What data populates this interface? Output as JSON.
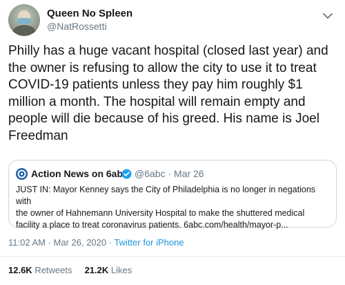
{
  "author": {
    "display_name": "Queen No Spleen",
    "handle": "@NatRossetti"
  },
  "tweet": {
    "text": "Philly has a huge vacant hospital (closed last year) and\nthe owner is refusing to allow the city to use it to treat\nCOVID-19 patients unless they pay him roughly $1\nmillion a month. The hospital will remain empty and\npeople will die because of his greed. His name is Joel\nFreedman"
  },
  "quoted_tweet": {
    "account_name": "Action News on 6abc",
    "handle_and_date": "@6abc · Mar 26",
    "text": "JUST IN: Mayor Kenney says the City of Philadelphia is no longer in negations with\nthe owner of Hahnemann University Hospital to make the shuttered medical\nfacility a place to treat coronavirus patients. 6abc.com/health/mayor-p..."
  },
  "meta": {
    "timestamp": "11:02 AM · Mar 26, 2020 · ",
    "source": "Twitter for iPhone"
  },
  "stats": {
    "retweets_count": "12.6K",
    "retweets_label": " Retweets",
    "likes_count": "21.2K",
    "likes_label": " Likes"
  },
  "colors": {
    "link": "#1b95e0",
    "secondary_text": "#657786",
    "verified": "#1da1f2"
  },
  "icons": {
    "menu": "chevron-down-icon",
    "verified": "verified-badge-icon",
    "logo": "6abc-logo-icon"
  }
}
